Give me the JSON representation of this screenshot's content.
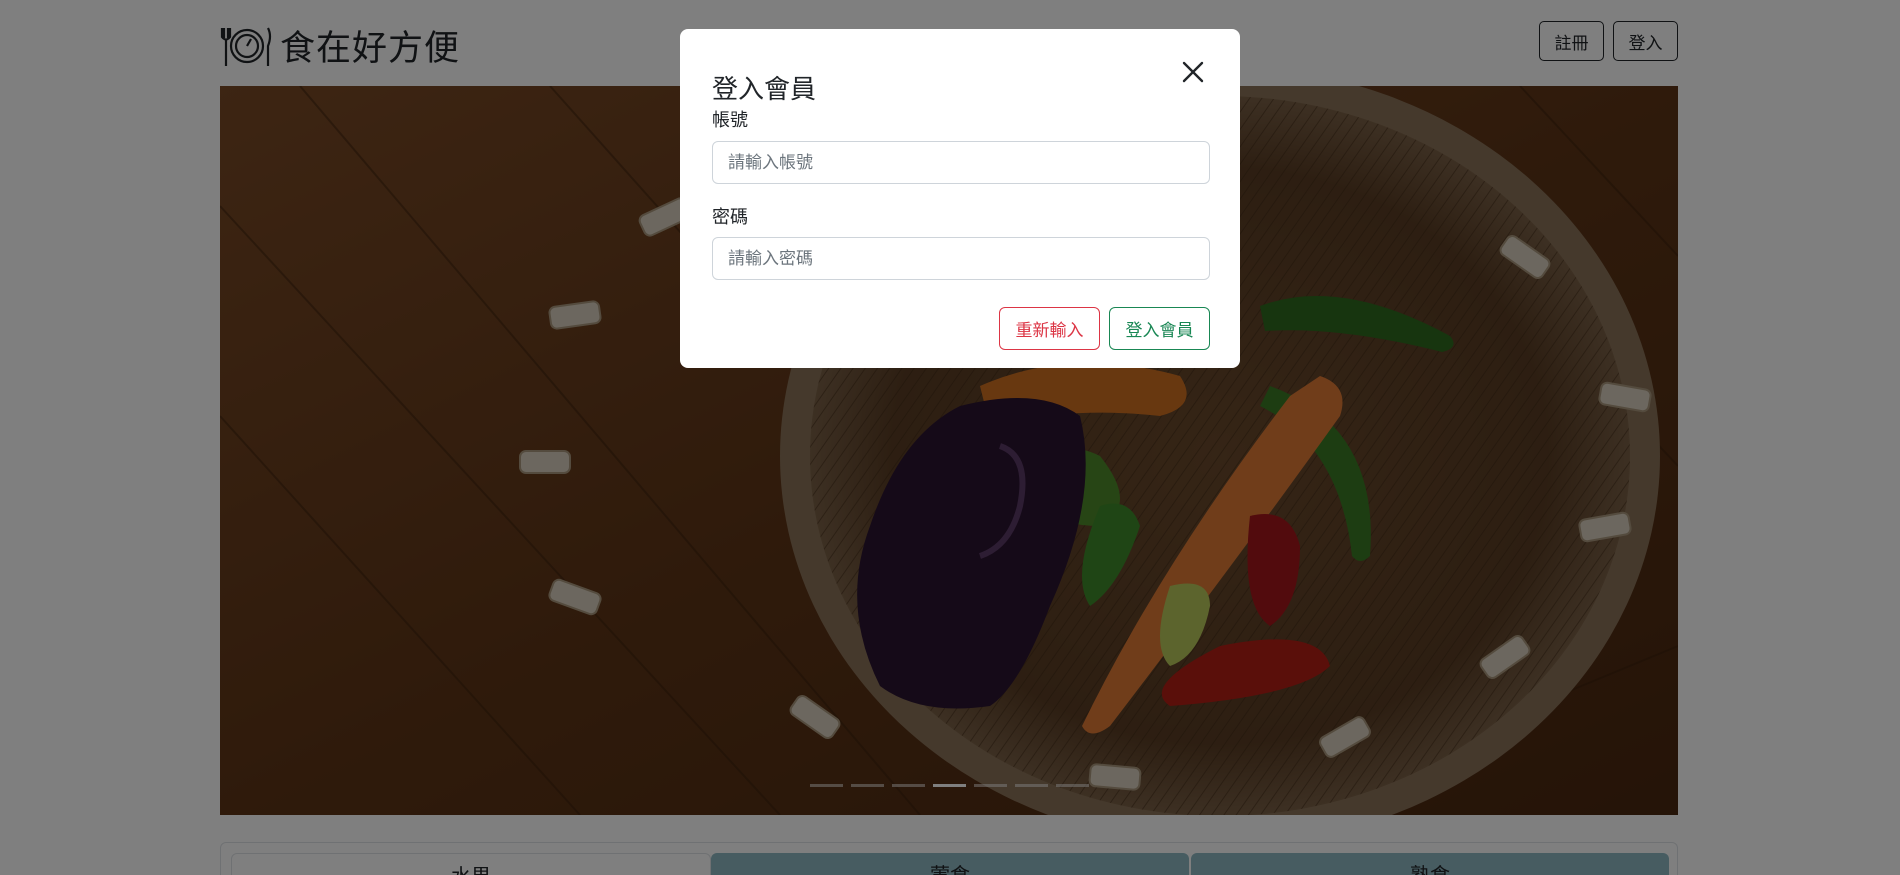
{
  "header": {
    "brand_title": "食在好方便",
    "register_label": "註冊",
    "login_label": "登入"
  },
  "carousel": {
    "indicator_count": 7,
    "active_index": 3
  },
  "categories": {
    "tabs": [
      {
        "label": "水果"
      },
      {
        "label": "葷食"
      },
      {
        "label": "熟食"
      }
    ]
  },
  "modal": {
    "title": "登入會員",
    "account_label": "帳號",
    "account_placeholder": "請輸入帳號",
    "password_label": "密碼",
    "password_placeholder": "請輸入密碼",
    "reset_label": "重新輸入",
    "submit_label": "登入會員"
  },
  "colors": {
    "reset": "#dc3545",
    "submit": "#198754",
    "tab_inactive": "#8fb9c3"
  }
}
